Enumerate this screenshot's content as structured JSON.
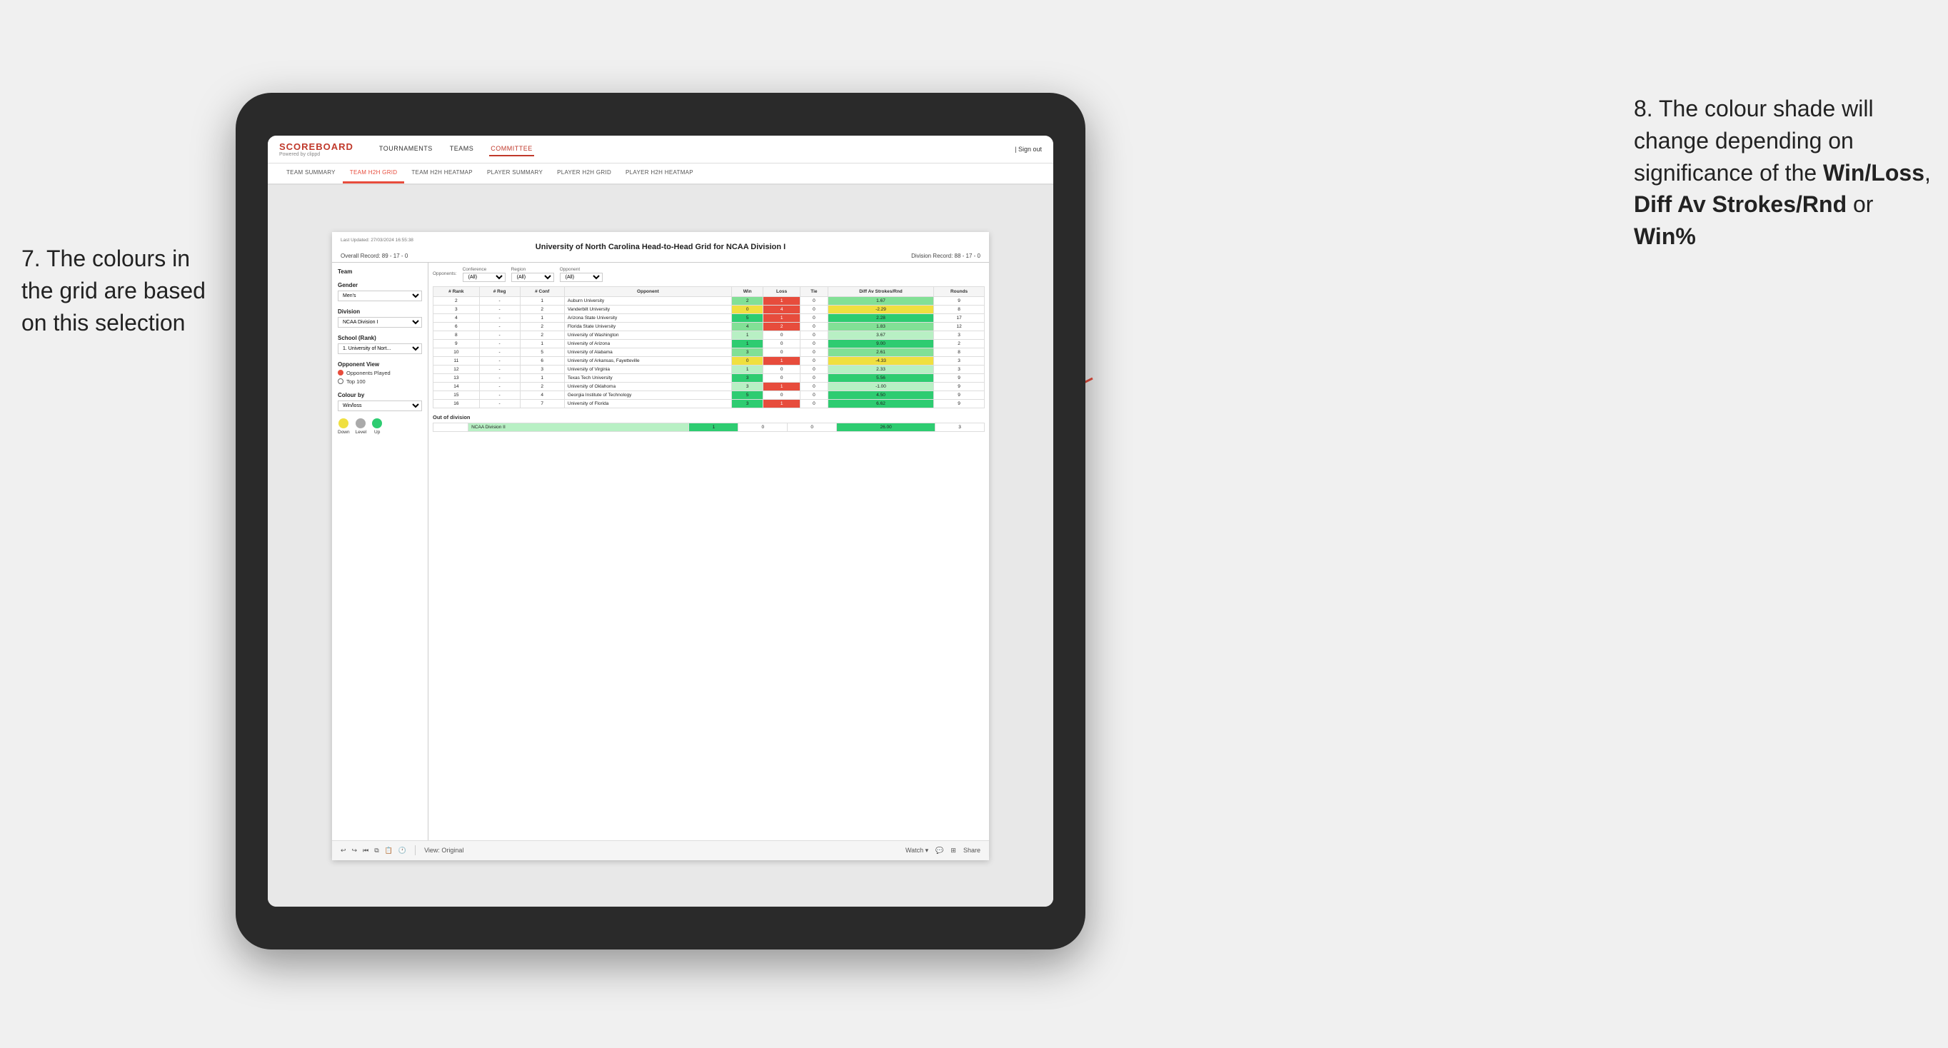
{
  "annotations": {
    "left": {
      "line1": "7. The colours in",
      "line2": "the grid are based",
      "line3": "on this selection"
    },
    "right": {
      "intro": "8. The colour shade will change depending on significance of the ",
      "bold1": "Win/Loss",
      "sep1": ", ",
      "bold2": "Diff Av Strokes/Rnd",
      "sep2": " or ",
      "bold3": "Win%"
    }
  },
  "nav": {
    "logo": "SCOREBOARD",
    "logo_sub": "Powered by clippd",
    "items": [
      "TOURNAMENTS",
      "TEAMS",
      "COMMITTEE"
    ],
    "sign_out": "| Sign out"
  },
  "sub_nav": {
    "items": [
      "TEAM SUMMARY",
      "TEAM H2H GRID",
      "TEAM H2H HEATMAP",
      "PLAYER SUMMARY",
      "PLAYER H2H GRID",
      "PLAYER H2H HEATMAP"
    ]
  },
  "report": {
    "timestamp": "Last Updated: 27/03/2024 16:55:38",
    "title": "University of North Carolina Head-to-Head Grid for NCAA Division I",
    "overall_record": "Overall Record: 89 - 17 - 0",
    "division_record": "Division Record: 88 - 17 - 0",
    "left_panel": {
      "team_label": "Team",
      "gender_label": "Gender",
      "gender_value": "Men's",
      "division_label": "Division",
      "division_value": "NCAA Division I",
      "school_label": "School (Rank)",
      "school_value": "1. University of Nort...",
      "opponent_view_label": "Opponent View",
      "opponents_played": "Opponents Played",
      "top_100": "Top 100",
      "colour_by_label": "Colour by",
      "colour_by_value": "Win/loss",
      "legend": {
        "down_label": "Down",
        "level_label": "Level",
        "up_label": "Up"
      }
    },
    "filters": {
      "opponents_label": "Opponents:",
      "opponents_value": "(All)",
      "conference_label": "Conference",
      "conference_value": "(All)",
      "region_label": "Region",
      "region_value": "(All)",
      "opponent_label": "Opponent",
      "opponent_value": "(All)"
    },
    "table": {
      "headers": [
        "# Rank",
        "# Reg",
        "# Conf",
        "Opponent",
        "Win",
        "Loss",
        "Tie",
        "Diff Av Strokes/Rnd",
        "Rounds"
      ],
      "rows": [
        {
          "rank": "2",
          "reg": "-",
          "conf": "1",
          "opponent": "Auburn University",
          "win": "2",
          "loss": "1",
          "tie": "0",
          "diff": "1.67",
          "rounds": "9",
          "win_color": "green_med",
          "loss_color": "white"
        },
        {
          "rank": "3",
          "reg": "-",
          "conf": "2",
          "opponent": "Vanderbilt University",
          "win": "0",
          "loss": "4",
          "tie": "0",
          "diff": "-2.29",
          "rounds": "8",
          "win_color": "yellow",
          "loss_color": "red"
        },
        {
          "rank": "4",
          "reg": "-",
          "conf": "1",
          "opponent": "Arizona State University",
          "win": "5",
          "loss": "1",
          "tie": "0",
          "diff": "2.28",
          "rounds": "17",
          "win_color": "green_dark",
          "loss_color": "white"
        },
        {
          "rank": "6",
          "reg": "-",
          "conf": "2",
          "opponent": "Florida State University",
          "win": "4",
          "loss": "2",
          "tie": "0",
          "diff": "1.83",
          "rounds": "12",
          "win_color": "green_med",
          "loss_color": "white"
        },
        {
          "rank": "8",
          "reg": "-",
          "conf": "2",
          "opponent": "University of Washington",
          "win": "1",
          "loss": "0",
          "tie": "0",
          "diff": "3.67",
          "rounds": "3",
          "win_color": "green_light",
          "loss_color": "white"
        },
        {
          "rank": "9",
          "reg": "-",
          "conf": "1",
          "opponent": "University of Arizona",
          "win": "1",
          "loss": "0",
          "tie": "0",
          "diff": "9.00",
          "rounds": "2",
          "win_color": "green_dark",
          "loss_color": "white"
        },
        {
          "rank": "10",
          "reg": "-",
          "conf": "5",
          "opponent": "University of Alabama",
          "win": "3",
          "loss": "0",
          "tie": "0",
          "diff": "2.61",
          "rounds": "8",
          "win_color": "green_med",
          "loss_color": "white"
        },
        {
          "rank": "11",
          "reg": "-",
          "conf": "6",
          "opponent": "University of Arkansas, Fayetteville",
          "win": "0",
          "loss": "1",
          "tie": "0",
          "diff": "-4.33",
          "rounds": "3",
          "win_color": "yellow",
          "loss_color": "red"
        },
        {
          "rank": "12",
          "reg": "-",
          "conf": "3",
          "opponent": "University of Virginia",
          "win": "1",
          "loss": "0",
          "tie": "0",
          "diff": "2.33",
          "rounds": "3",
          "win_color": "green_light",
          "loss_color": "white"
        },
        {
          "rank": "13",
          "reg": "-",
          "conf": "1",
          "opponent": "Texas Tech University",
          "win": "3",
          "loss": "0",
          "tie": "0",
          "diff": "5.56",
          "rounds": "9",
          "win_color": "green_dark",
          "loss_color": "white"
        },
        {
          "rank": "14",
          "reg": "-",
          "conf": "2",
          "opponent": "University of Oklahoma",
          "win": "3",
          "loss": "1",
          "tie": "0",
          "diff": "-1.00",
          "rounds": "9",
          "win_color": "green_light",
          "loss_color": "white"
        },
        {
          "rank": "15",
          "reg": "-",
          "conf": "4",
          "opponent": "Georgia Institute of Technology",
          "win": "5",
          "loss": "0",
          "tie": "0",
          "diff": "4.50",
          "rounds": "9",
          "win_color": "green_dark",
          "loss_color": "white"
        },
        {
          "rank": "16",
          "reg": "-",
          "conf": "7",
          "opponent": "University of Florida",
          "win": "3",
          "loss": "1",
          "tie": "0",
          "diff": "6.62",
          "rounds": "9",
          "win_color": "green_dark",
          "loss_color": "white"
        }
      ],
      "out_of_division": {
        "label": "Out of division",
        "row": {
          "division": "NCAA Division II",
          "win": "1",
          "loss": "0",
          "tie": "0",
          "diff": "26.00",
          "rounds": "3",
          "win_color": "green_dark"
        }
      }
    },
    "toolbar": {
      "view_label": "View: Original",
      "watch_label": "Watch ▾",
      "share_label": "Share"
    }
  }
}
